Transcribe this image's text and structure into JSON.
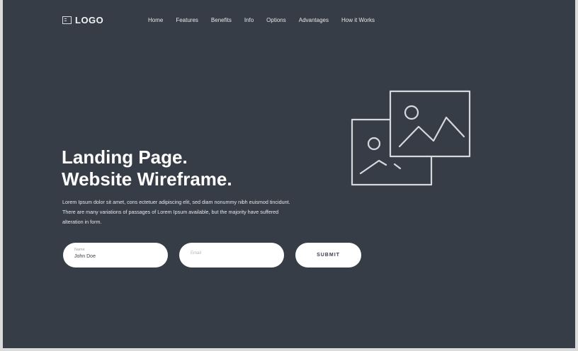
{
  "logo": {
    "text": "LOGO",
    "icon": "logo-icon"
  },
  "nav": {
    "items": [
      {
        "label": "Home"
      },
      {
        "label": "Features"
      },
      {
        "label": "Benefits"
      },
      {
        "label": "Info"
      },
      {
        "label": "Options"
      },
      {
        "label": "Advantages"
      },
      {
        "label": "How it Works"
      }
    ]
  },
  "hero": {
    "title_line1": "Landing Page.",
    "title_line2": "Website Wireframe.",
    "description": "Lorem Ipsum dolor sit amet, cons ectetuer adipiscing elit, sed diam nonummy nibh euismod tincidunt. There are many variations of passages of Lorem Ipsum available, but the majority have suffered alteration in form.",
    "image_icon": "image-gallery-icon"
  },
  "form": {
    "name_label": "Name",
    "name_value": "John Doe",
    "email_placeholder": "Email",
    "submit_label": "SUBMIT"
  },
  "colors": {
    "background": "#363d47",
    "page_edge": "#d9dadb",
    "text": "#ffffff",
    "button": "#ffffff"
  }
}
